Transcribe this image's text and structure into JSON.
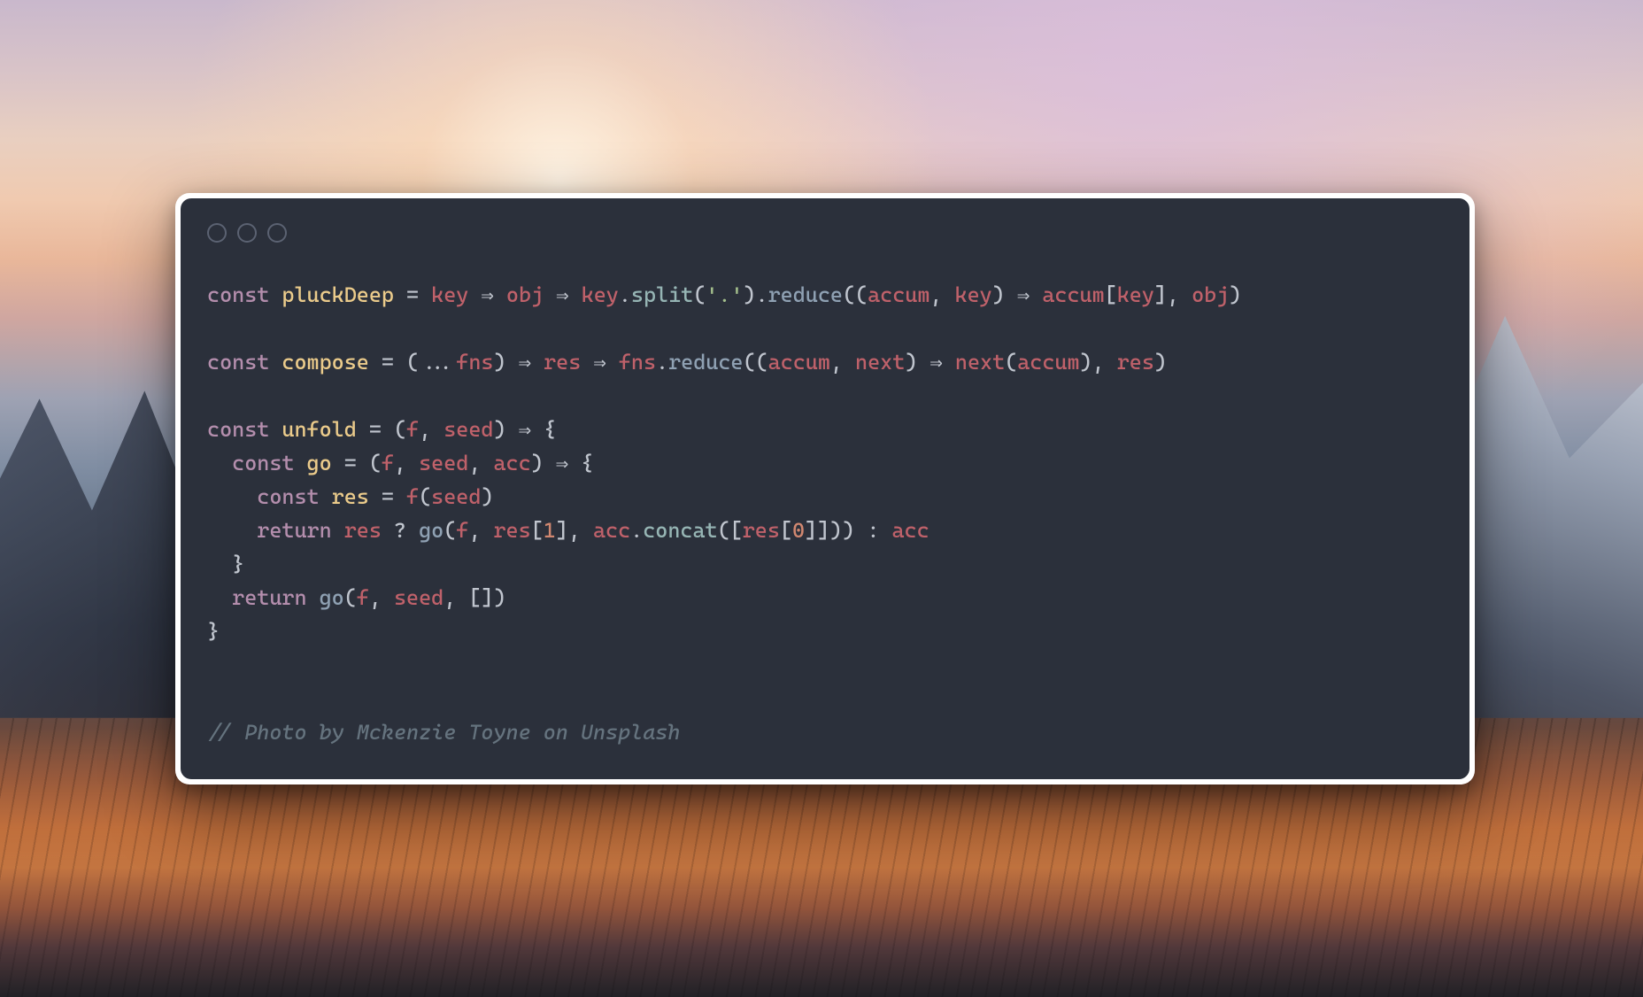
{
  "background_credit_comment": "// Photo by Mckenzie Toyne on Unsplash",
  "editor": {
    "theme_bg": "#2b303b",
    "frame_bg": "#ffffff",
    "language": "javascript"
  },
  "code_plain": "const pluckDeep = key => obj => key.split('.').reduce((accum, key) => accum[key], obj)\n\nconst compose = (...fns) => res => fns.reduce((accum, next) => next(accum), res)\n\nconst unfold = (f, seed) => {\n  const go = (f, seed, acc) => {\n    const res = f(seed)\n    return res ? go(f, res[1], acc.concat([res[0]])) : acc\n  }\n  return go(f, seed, [])\n}\n\n\n// Photo by Mckenzie Toyne on Unsplash",
  "code_tokens": [
    [
      {
        "t": "const ",
        "c": "kw"
      },
      {
        "t": "pluckDeep",
        "c": "nm"
      },
      {
        "t": " = ",
        "c": "op"
      },
      {
        "t": "key",
        "c": "id"
      },
      {
        "t": " ",
        "c": "op"
      },
      {
        "t": "=>",
        "c": "arrow"
      },
      {
        "t": " ",
        "c": "op"
      },
      {
        "t": "obj",
        "c": "id"
      },
      {
        "t": " ",
        "c": "op"
      },
      {
        "t": "=>",
        "c": "arrow"
      },
      {
        "t": " ",
        "c": "op"
      },
      {
        "t": "key",
        "c": "id"
      },
      {
        "t": ".",
        "c": "op"
      },
      {
        "t": "split",
        "c": "call2"
      },
      {
        "t": "(",
        "c": "brk"
      },
      {
        "t": "'.'",
        "c": "str"
      },
      {
        "t": ")",
        "c": "brk"
      },
      {
        "t": ".",
        "c": "op"
      },
      {
        "t": "reduce",
        "c": "call"
      },
      {
        "t": "((",
        "c": "brk"
      },
      {
        "t": "accum",
        "c": "id"
      },
      {
        "t": ", ",
        "c": "op"
      },
      {
        "t": "key",
        "c": "id"
      },
      {
        "t": ") ",
        "c": "brk"
      },
      {
        "t": "=>",
        "c": "arrow"
      },
      {
        "t": " ",
        "c": "op"
      },
      {
        "t": "accum",
        "c": "id"
      },
      {
        "t": "[",
        "c": "brk"
      },
      {
        "t": "key",
        "c": "id"
      },
      {
        "t": "]",
        "c": "brk"
      },
      {
        "t": ", ",
        "c": "op"
      },
      {
        "t": "obj",
        "c": "id"
      },
      {
        "t": ")",
        "c": "brk"
      }
    ],
    [],
    [
      {
        "t": "const ",
        "c": "kw"
      },
      {
        "t": "compose",
        "c": "nm"
      },
      {
        "t": " = (",
        "c": "op"
      },
      {
        "t": "...",
        "c": "op"
      },
      {
        "t": "fns",
        "c": "id"
      },
      {
        "t": ") ",
        "c": "brk"
      },
      {
        "t": "=>",
        "c": "arrow"
      },
      {
        "t": " ",
        "c": "op"
      },
      {
        "t": "res",
        "c": "id"
      },
      {
        "t": " ",
        "c": "op"
      },
      {
        "t": "=>",
        "c": "arrow"
      },
      {
        "t": " ",
        "c": "op"
      },
      {
        "t": "fns",
        "c": "id"
      },
      {
        "t": ".",
        "c": "op"
      },
      {
        "t": "reduce",
        "c": "call"
      },
      {
        "t": "((",
        "c": "brk"
      },
      {
        "t": "accum",
        "c": "id"
      },
      {
        "t": ", ",
        "c": "op"
      },
      {
        "t": "next",
        "c": "id"
      },
      {
        "t": ") ",
        "c": "brk"
      },
      {
        "t": "=>",
        "c": "arrow"
      },
      {
        "t": " ",
        "c": "op"
      },
      {
        "t": "next",
        "c": "id"
      },
      {
        "t": "(",
        "c": "brk"
      },
      {
        "t": "accum",
        "c": "id"
      },
      {
        "t": ")",
        "c": "brk"
      },
      {
        "t": ", ",
        "c": "op"
      },
      {
        "t": "res",
        "c": "id"
      },
      {
        "t": ")",
        "c": "brk"
      }
    ],
    [],
    [
      {
        "t": "const ",
        "c": "kw"
      },
      {
        "t": "unfold",
        "c": "nm"
      },
      {
        "t": " = (",
        "c": "op"
      },
      {
        "t": "f",
        "c": "id"
      },
      {
        "t": ", ",
        "c": "op"
      },
      {
        "t": "seed",
        "c": "id"
      },
      {
        "t": ") ",
        "c": "brk"
      },
      {
        "t": "=>",
        "c": "arrow"
      },
      {
        "t": " {",
        "c": "brk"
      }
    ],
    [
      {
        "t": "  ",
        "c": "op"
      },
      {
        "t": "const ",
        "c": "kw"
      },
      {
        "t": "go",
        "c": "nm"
      },
      {
        "t": " = (",
        "c": "op"
      },
      {
        "t": "f",
        "c": "id"
      },
      {
        "t": ", ",
        "c": "op"
      },
      {
        "t": "seed",
        "c": "id"
      },
      {
        "t": ", ",
        "c": "op"
      },
      {
        "t": "acc",
        "c": "id"
      },
      {
        "t": ") ",
        "c": "brk"
      },
      {
        "t": "=>",
        "c": "arrow"
      },
      {
        "t": " {",
        "c": "brk"
      }
    ],
    [
      {
        "t": "    ",
        "c": "op"
      },
      {
        "t": "const ",
        "c": "kw"
      },
      {
        "t": "res",
        "c": "nm"
      },
      {
        "t": " = ",
        "c": "op"
      },
      {
        "t": "f",
        "c": "id"
      },
      {
        "t": "(",
        "c": "brk"
      },
      {
        "t": "seed",
        "c": "id"
      },
      {
        "t": ")",
        "c": "brk"
      }
    ],
    [
      {
        "t": "    ",
        "c": "op"
      },
      {
        "t": "return ",
        "c": "kw"
      },
      {
        "t": "res",
        "c": "id"
      },
      {
        "t": " ? ",
        "c": "op"
      },
      {
        "t": "go",
        "c": "call"
      },
      {
        "t": "(",
        "c": "brk"
      },
      {
        "t": "f",
        "c": "id"
      },
      {
        "t": ", ",
        "c": "op"
      },
      {
        "t": "res",
        "c": "id"
      },
      {
        "t": "[",
        "c": "brk"
      },
      {
        "t": "1",
        "c": "num"
      },
      {
        "t": "]",
        "c": "brk"
      },
      {
        "t": ", ",
        "c": "op"
      },
      {
        "t": "acc",
        "c": "id"
      },
      {
        "t": ".",
        "c": "op"
      },
      {
        "t": "concat",
        "c": "call2"
      },
      {
        "t": "([",
        "c": "brk"
      },
      {
        "t": "res",
        "c": "id"
      },
      {
        "t": "[",
        "c": "brk"
      },
      {
        "t": "0",
        "c": "num"
      },
      {
        "t": "]",
        "c": "brk"
      },
      {
        "t": "]))",
        "c": "brk"
      },
      {
        "t": " : ",
        "c": "op"
      },
      {
        "t": "acc",
        "c": "id"
      }
    ],
    [
      {
        "t": "  }",
        "c": "brk"
      }
    ],
    [
      {
        "t": "  ",
        "c": "op"
      },
      {
        "t": "return ",
        "c": "kw"
      },
      {
        "t": "go",
        "c": "call"
      },
      {
        "t": "(",
        "c": "brk"
      },
      {
        "t": "f",
        "c": "id"
      },
      {
        "t": ", ",
        "c": "op"
      },
      {
        "t": "seed",
        "c": "id"
      },
      {
        "t": ", [])",
        "c": "brk"
      }
    ],
    [
      {
        "t": "}",
        "c": "brk"
      }
    ],
    [],
    [],
    [
      {
        "t": "// Photo by Mckenzie Toyne on Unsplash",
        "c": "cmt"
      }
    ]
  ]
}
